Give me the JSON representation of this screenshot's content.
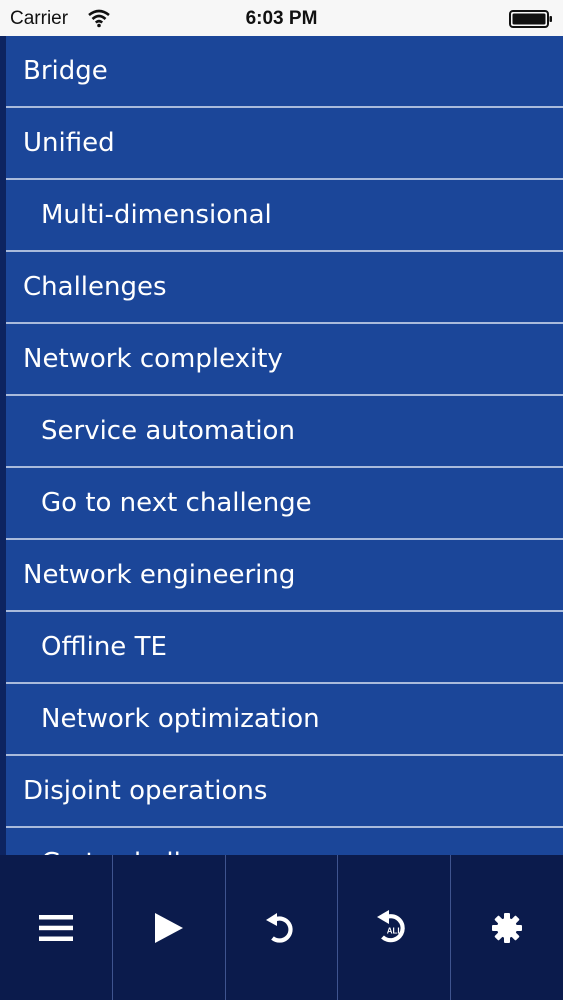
{
  "status_bar": {
    "carrier": "Carrier",
    "time": "6:03 PM"
  },
  "menu": {
    "items": [
      {
        "label": "Bridge",
        "level": 0
      },
      {
        "label": "Unified",
        "level": 0
      },
      {
        "label": "Multi-dimensional",
        "level": 1
      },
      {
        "label": "Challenges",
        "level": 0
      },
      {
        "label": "Network complexity",
        "level": 0
      },
      {
        "label": "Service automation",
        "level": 1
      },
      {
        "label": "Go to next challenge",
        "level": 1
      },
      {
        "label": "Network engineering",
        "level": 0
      },
      {
        "label": "Offline TE",
        "level": 1
      },
      {
        "label": "Network optimization",
        "level": 1
      },
      {
        "label": "Disjoint operations",
        "level": 0
      },
      {
        "label": "Go to challenge",
        "level": 1
      }
    ]
  },
  "toolbar": {
    "buttons": [
      {
        "name": "menu-button",
        "icon": "hamburger-menu-icon"
      },
      {
        "name": "play-button",
        "icon": "play-icon"
      },
      {
        "name": "replay-button",
        "icon": "replay-icon"
      },
      {
        "name": "replay-all-button",
        "icon": "replay-all-icon",
        "badge": "ALL"
      },
      {
        "name": "settings-button",
        "icon": "gear-icon"
      }
    ]
  },
  "colors": {
    "menu_background": "#1b4699",
    "menu_divider": "#a9bbdc",
    "toolbar_background": "#0b1b4c",
    "text": "#ffffff"
  }
}
